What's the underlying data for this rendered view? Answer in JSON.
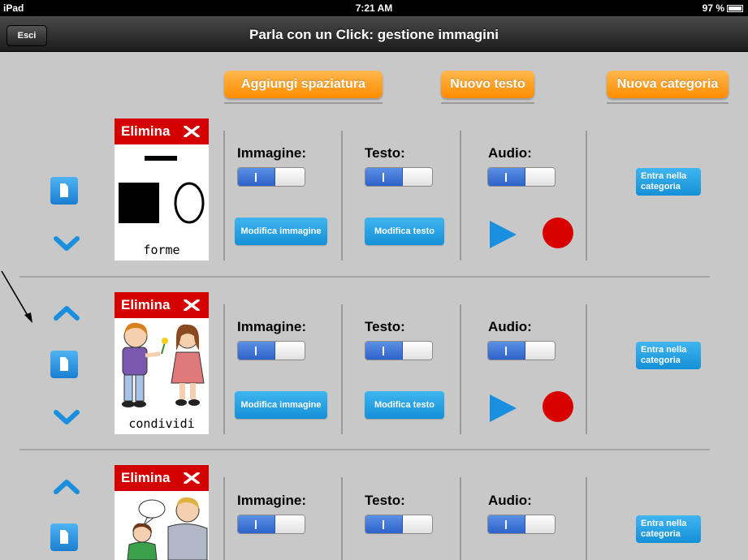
{
  "statusbar": {
    "device": "iPad",
    "time": "7:21 AM",
    "battery": "97 %"
  },
  "navbar": {
    "exit_label": "Esci",
    "title": "Parla con un Click: gestione immagini"
  },
  "toolbar": {
    "add_spacing": "Aggiungi spaziatura",
    "new_text": "Nuovo testo",
    "new_category": "Nuova categoria"
  },
  "labels": {
    "delete": "Elimina",
    "image": "Immagine:",
    "text": "Testo:",
    "audio": "Audio:",
    "edit_image": "Modifica immagine",
    "edit_text": "Modifica testo",
    "enter_category": "Entra nella categoria"
  },
  "rows": [
    {
      "card_label": "forme",
      "picture": "shapes-picture",
      "image_on": true,
      "text_on": true,
      "audio_on": true
    },
    {
      "card_label": "condividi",
      "picture": "children-sharing-picture",
      "image_on": true,
      "text_on": true,
      "audio_on": true
    },
    {
      "card_label": "",
      "picture": "adult-child-talking-picture",
      "image_on": true,
      "text_on": true,
      "audio_on": true
    }
  ],
  "colors": {
    "orange": "#ff8c00",
    "blue": "#1490d8",
    "red": "#d40000",
    "background": "#c8c8c8"
  }
}
